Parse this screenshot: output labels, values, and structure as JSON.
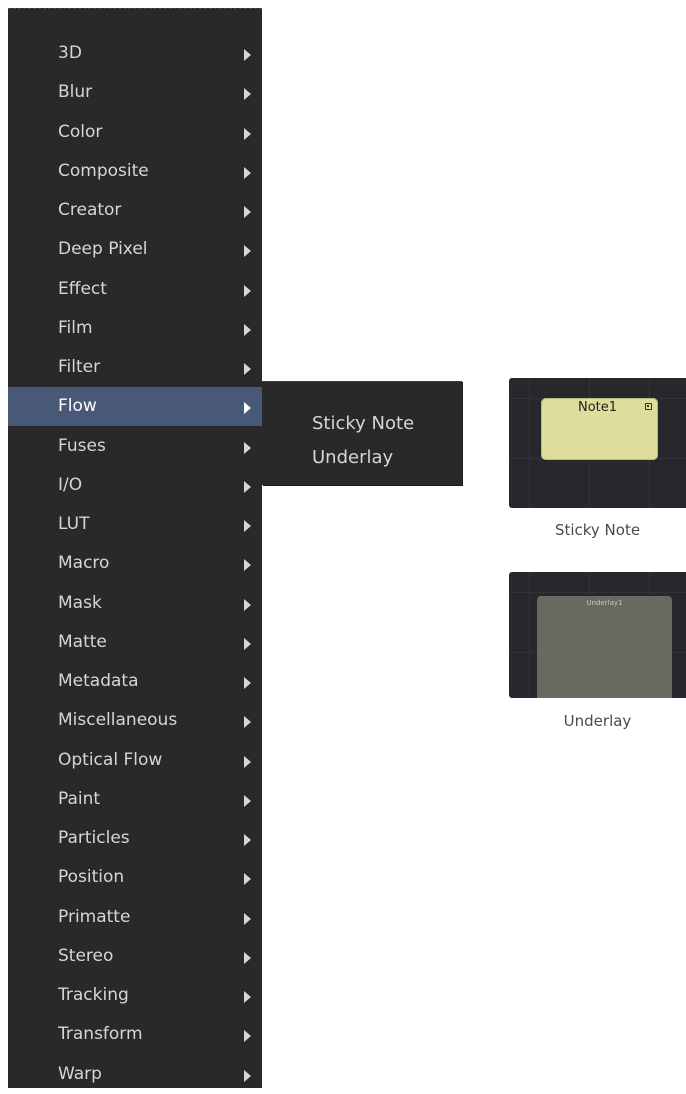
{
  "menu": {
    "items": [
      {
        "label": "3D"
      },
      {
        "label": "Blur"
      },
      {
        "label": "Color"
      },
      {
        "label": "Composite"
      },
      {
        "label": "Creator"
      },
      {
        "label": "Deep Pixel"
      },
      {
        "label": "Effect"
      },
      {
        "label": "Film"
      },
      {
        "label": "Filter"
      },
      {
        "label": "Flow"
      },
      {
        "label": "Fuses"
      },
      {
        "label": "I/O"
      },
      {
        "label": "LUT"
      },
      {
        "label": "Macro"
      },
      {
        "label": "Mask"
      },
      {
        "label": "Matte"
      },
      {
        "label": "Metadata"
      },
      {
        "label": "Miscellaneous"
      },
      {
        "label": "Optical Flow"
      },
      {
        "label": "Paint"
      },
      {
        "label": "Particles"
      },
      {
        "label": "Position"
      },
      {
        "label": "Primatte"
      },
      {
        "label": "Stereo"
      },
      {
        "label": "Tracking"
      },
      {
        "label": "Transform"
      },
      {
        "label": "Warp"
      }
    ],
    "active_label": "Flow"
  },
  "submenu": {
    "items": [
      {
        "label": "Sticky Note"
      },
      {
        "label": "Underlay"
      }
    ]
  },
  "previews": {
    "sticky_note": {
      "node_title": "Note1",
      "caption": "Sticky Note",
      "color": "#ddde9c"
    },
    "underlay": {
      "node_title": "Underlay1",
      "caption": "Underlay",
      "color": "#69695f"
    }
  },
  "colors": {
    "menu_bg": "#29292c",
    "highlight": "#485977",
    "text": "#d6d6d6"
  }
}
